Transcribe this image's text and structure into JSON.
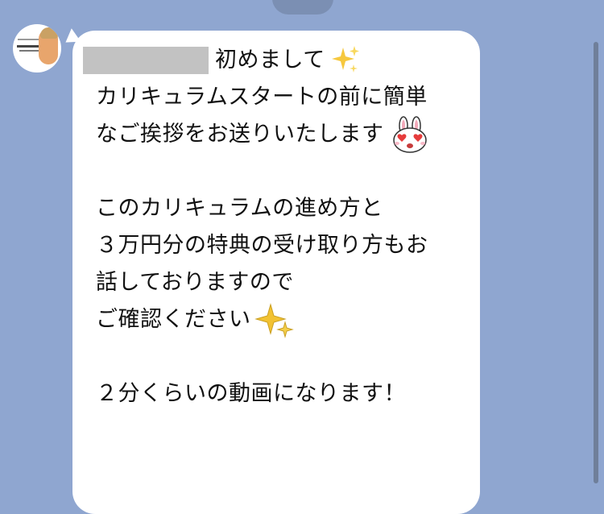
{
  "chat": {
    "message": {
      "redacted_name": "",
      "line1": "初めまして",
      "line2": "カリキュラムスタートの前に簡単",
      "line3": "なご挨拶をお送りいたします",
      "line4": "このカリキュラムの進め方と",
      "line5": "３万円分の特典の受け取り方もお",
      "line6": "話しておりますので",
      "line7": "ご確認ください",
      "line8": "２分くらいの動画になります！"
    },
    "icons": {
      "avatar": "sender-avatar",
      "sparkle": "sparkles-emoji",
      "bunny": "bunny-heart-eyes-emoji"
    },
    "colors": {
      "background": "#8fa6d0",
      "bubble": "#ffffff",
      "redaction": "#c2c2c2"
    }
  }
}
